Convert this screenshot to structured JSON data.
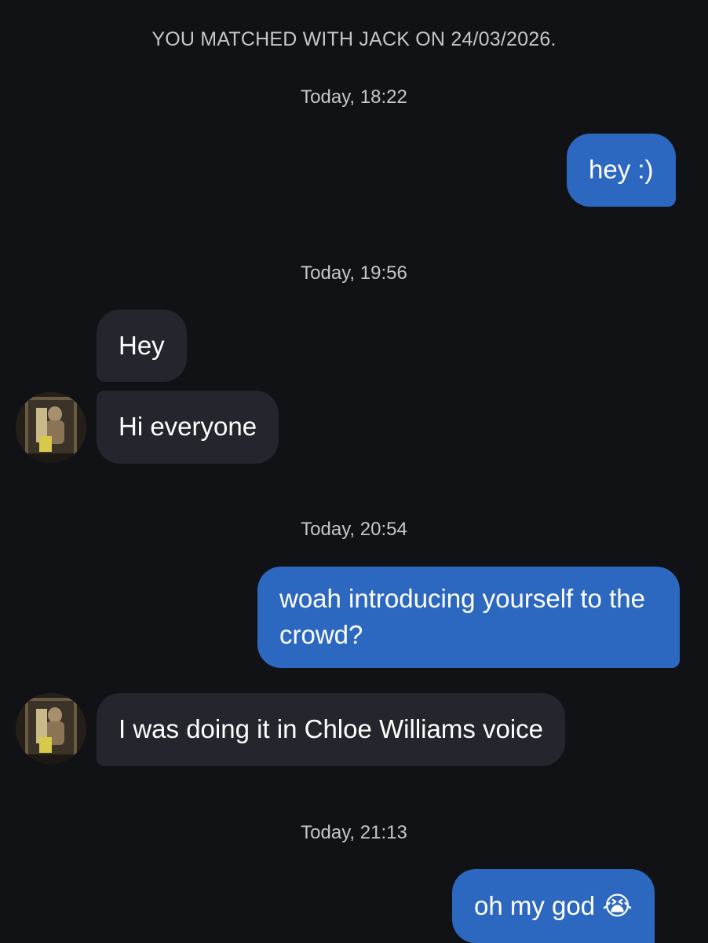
{
  "conversation": {
    "match_banner": "YOU MATCHED WITH JACK ON 24/03/2026.",
    "groups": [
      {
        "timestamp": "Today, 18:22",
        "messages": [
          {
            "from": "me",
            "text": "hey :)"
          }
        ]
      },
      {
        "timestamp": "Today, 19:56",
        "messages": [
          {
            "from": "jack",
            "text": "Hey"
          },
          {
            "from": "jack",
            "text": "Hi everyone"
          }
        ]
      },
      {
        "timestamp": "Today, 20:54",
        "messages": [
          {
            "from": "me",
            "text": "woah introducing yourself to the crowd?"
          },
          {
            "from": "jack",
            "text": "I was doing it in Chloe Williams voice"
          }
        ]
      },
      {
        "timestamp": "Today, 21:13",
        "messages": [
          {
            "from": "me",
            "text": "oh my god 😭"
          }
        ]
      }
    ]
  },
  "colors": {
    "background": "#111216",
    "sent_bubble": "#2d68c0",
    "received_bubble": "#23262c",
    "meta_text": "#c4c6cc"
  },
  "icons": {
    "avatar": "profile-photo-avatar"
  }
}
